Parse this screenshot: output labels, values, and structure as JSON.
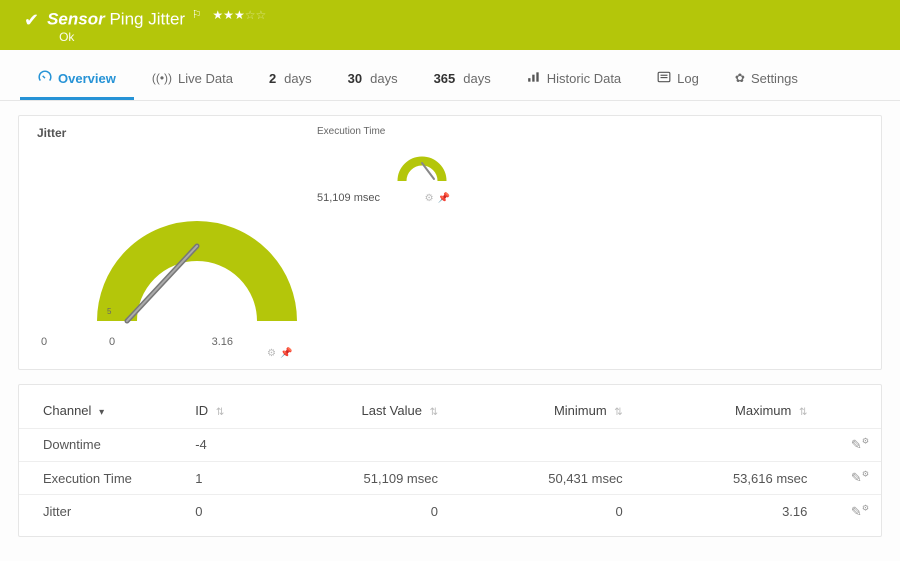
{
  "header": {
    "sensor_label": "Sensor",
    "sensor_name": "Ping Jitter",
    "status": "Ok",
    "stars_filled": 3,
    "stars_total": 5
  },
  "tabs": {
    "overview": "Overview",
    "live_data": "Live Data",
    "days2_num": "2",
    "days2_suffix": "days",
    "days30_num": "30",
    "days30_suffix": "days",
    "days365_num": "365",
    "days365_suffix": "days",
    "historic": "Historic Data",
    "log": "Log",
    "settings": "Settings"
  },
  "gauges": {
    "jitter": {
      "title": "Jitter",
      "outer_zero": "0",
      "scale_min": "0",
      "scale_max": "3.16"
    },
    "exec": {
      "title": "Execution Time",
      "value": "51,109 msec"
    }
  },
  "table": {
    "headers": {
      "channel": "Channel",
      "id": "ID",
      "last_value": "Last Value",
      "minimum": "Minimum",
      "maximum": "Maximum"
    },
    "rows": [
      {
        "channel": "Downtime",
        "id": "-4",
        "last": "",
        "min": "",
        "max": ""
      },
      {
        "channel": "Execution Time",
        "id": "1",
        "last": "51,109 msec",
        "min": "50,431 msec",
        "max": "53,616 msec"
      },
      {
        "channel": "Jitter",
        "id": "0",
        "last": "0",
        "min": "0",
        "max": "3.16"
      }
    ]
  },
  "chart_data": [
    {
      "type": "gauge",
      "title": "Jitter",
      "value": 0,
      "min": 0,
      "max": 3.16,
      "unit": ""
    },
    {
      "type": "gauge",
      "title": "Execution Time",
      "value": 51109,
      "unit": "msec"
    }
  ]
}
